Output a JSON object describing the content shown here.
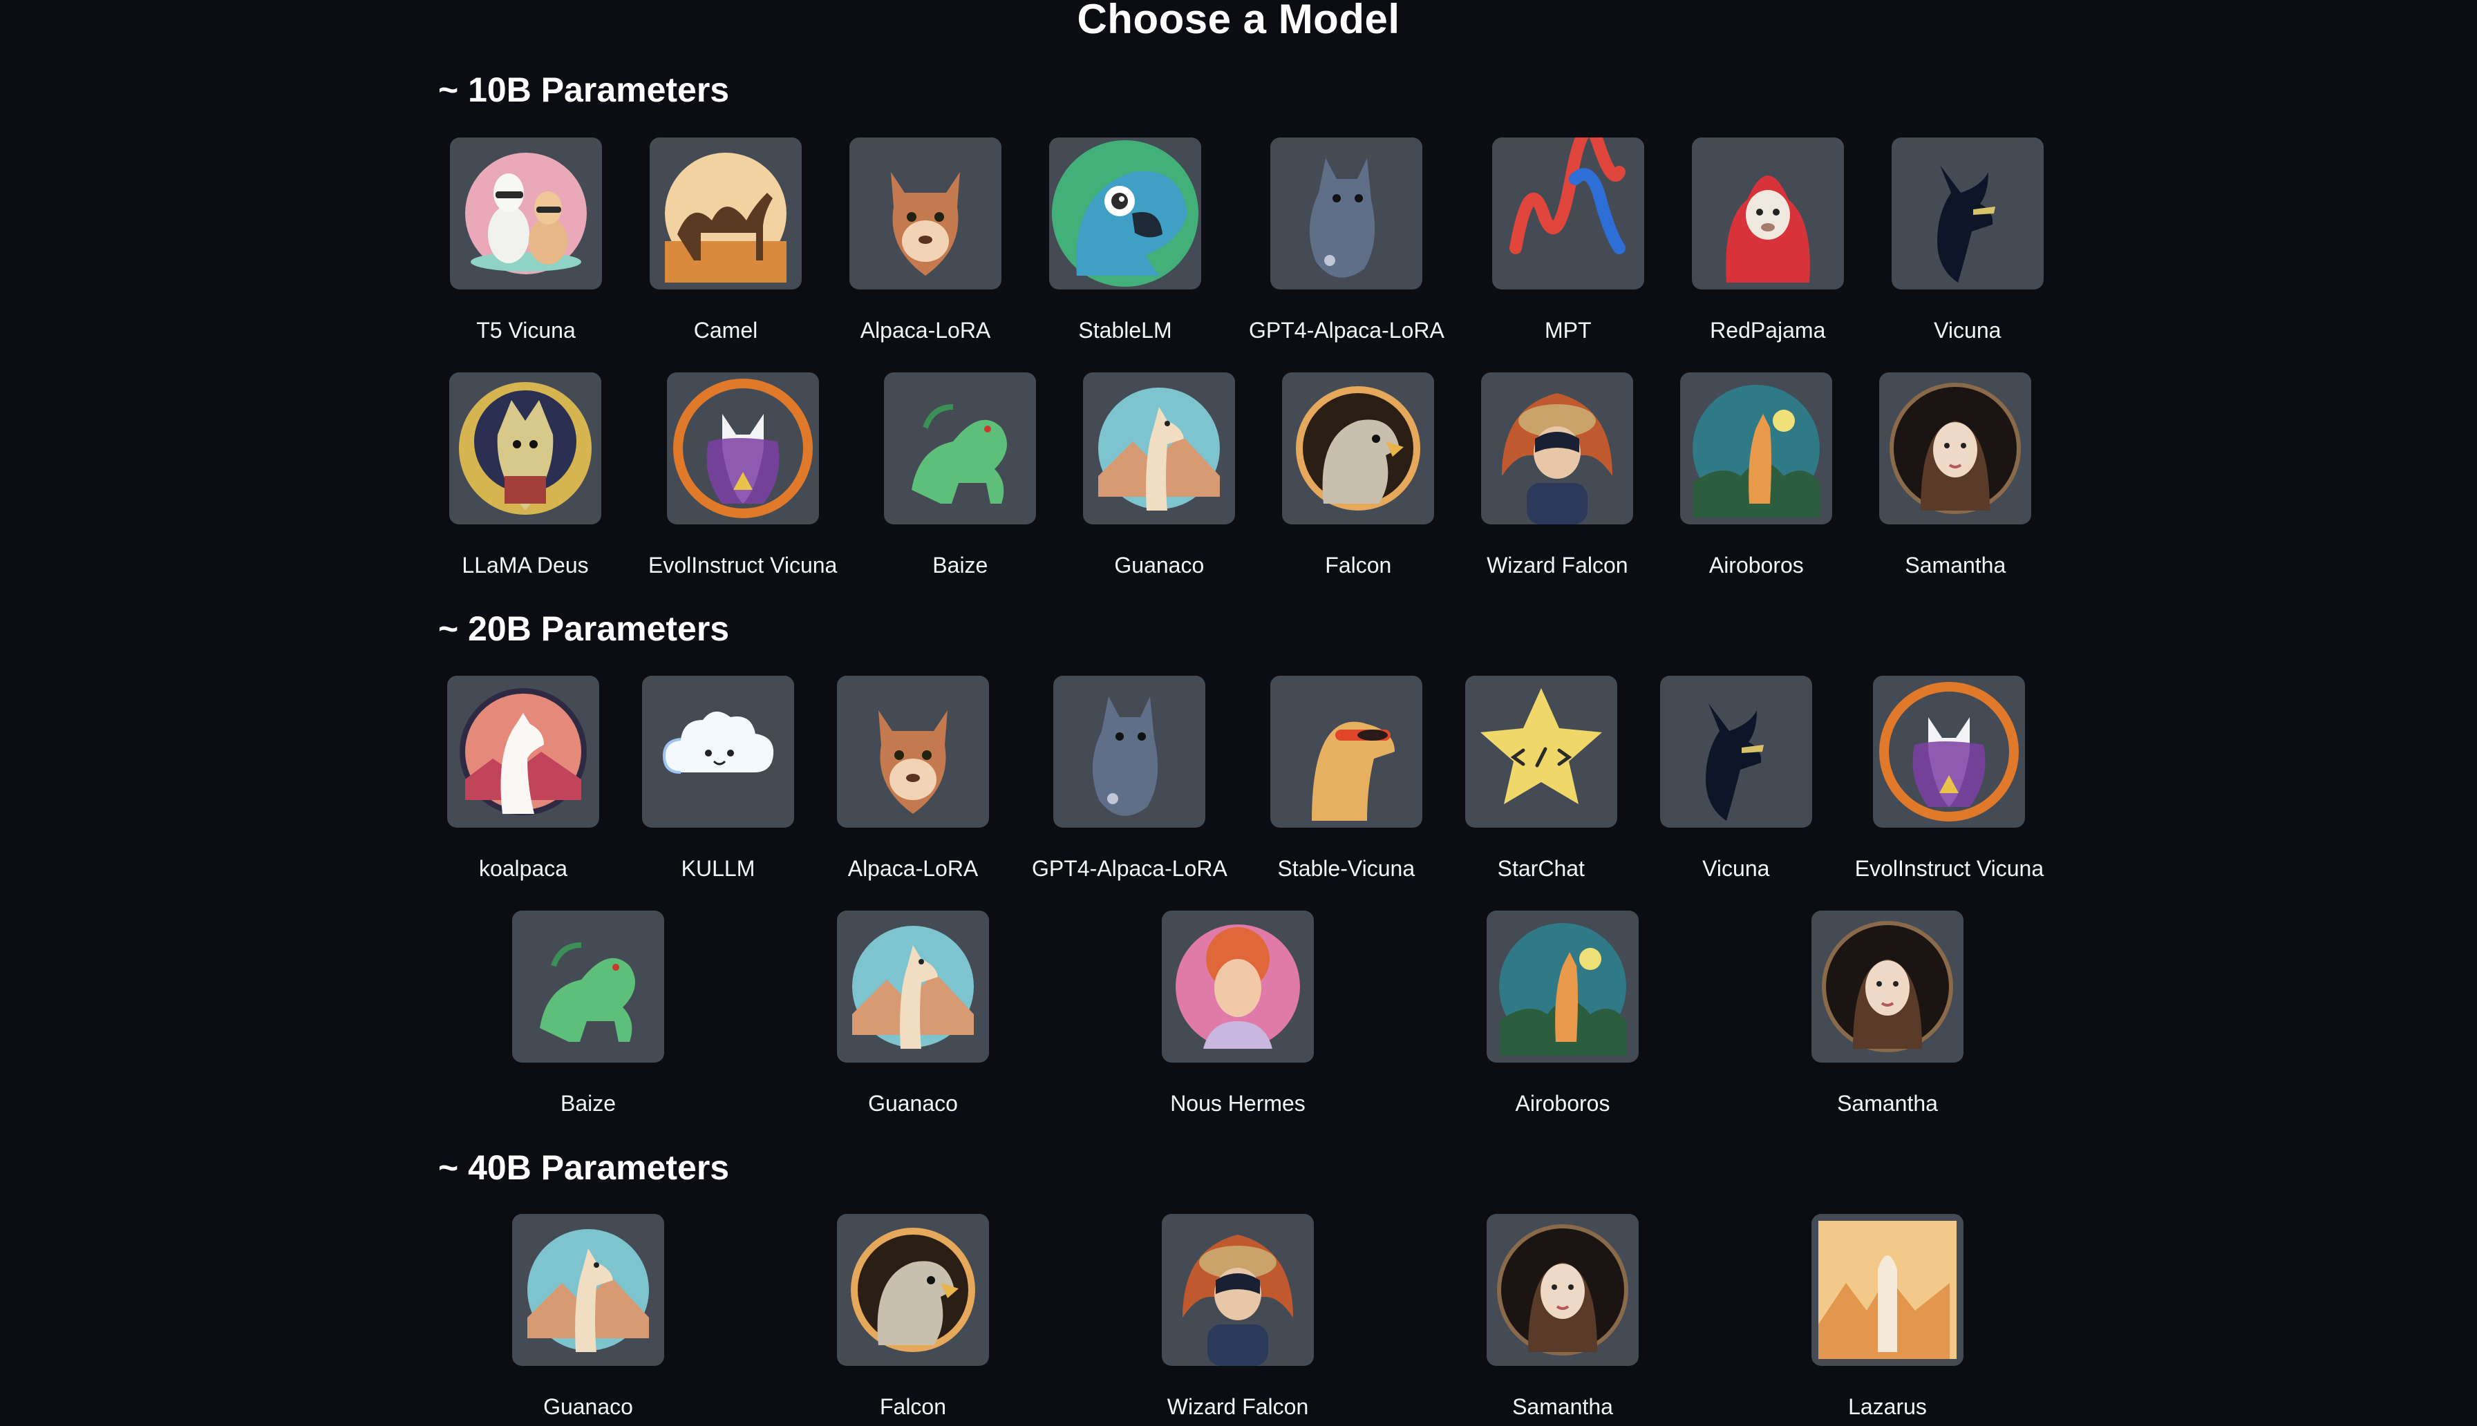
{
  "page": {
    "title": "Choose a Model"
  },
  "sections": [
    {
      "title": "~ 10B Parameters",
      "rows": [
        [
          {
            "label": "T5 Vicuna",
            "icon": "two-llamas-icon"
          },
          {
            "label": "Camel",
            "icon": "camel-icon"
          },
          {
            "label": "Alpaca-LoRA",
            "icon": "alpaca-icon"
          },
          {
            "label": "StableLM",
            "icon": "parrot-icon"
          },
          {
            "label": "GPT4-Alpaca-LoRA",
            "icon": "gray-llama-icon"
          },
          {
            "label": "MPT",
            "icon": "mpt-logo-icon"
          },
          {
            "label": "RedPajama",
            "icon": "llama-hoodie-icon"
          },
          {
            "label": "Vicuna",
            "icon": "vicuna-silhouette-icon"
          }
        ],
        [
          {
            "label": "LLaMA Deus",
            "icon": "llama-deus-icon"
          },
          {
            "label": "EvolInstruct Vicuna",
            "icon": "wizard-fox-icon"
          },
          {
            "label": "Baize",
            "icon": "green-dragon-icon"
          },
          {
            "label": "Guanaco",
            "icon": "guanaco-icon"
          },
          {
            "label": "Falcon",
            "icon": "falcon-icon"
          },
          {
            "label": "Wizard Falcon",
            "icon": "wizard-falcon-icon"
          },
          {
            "label": "Airoboros",
            "icon": "airoboros-icon"
          },
          {
            "label": "Samantha",
            "icon": "samantha-icon"
          }
        ]
      ]
    },
    {
      "title": "~ 20B Parameters",
      "rows": [
        [
          {
            "label": "koalpaca",
            "icon": "koalpaca-icon"
          },
          {
            "label": "KULLM",
            "icon": "cloud-icon"
          },
          {
            "label": "Alpaca-LoRA",
            "icon": "alpaca-icon"
          },
          {
            "label": "GPT4-Alpaca-LoRA",
            "icon": "gray-llama-icon"
          },
          {
            "label": "Stable-Vicuna",
            "icon": "llama-sunglasses-icon"
          },
          {
            "label": "StarChat",
            "icon": "star-code-icon"
          },
          {
            "label": "Vicuna",
            "icon": "vicuna-silhouette-icon"
          },
          {
            "label": "EvolInstruct Vicuna",
            "icon": "wizard-fox-icon"
          }
        ],
        [
          {
            "label": "Baize",
            "icon": "green-dragon-icon"
          },
          {
            "label": "Guanaco",
            "icon": "guanaco-icon"
          },
          {
            "label": "Nous Hermes",
            "icon": "hermes-bust-icon"
          },
          {
            "label": "Airoboros",
            "icon": "airoboros-icon"
          },
          {
            "label": "Samantha",
            "icon": "samantha-icon"
          }
        ]
      ]
    },
    {
      "title": "~ 40B Parameters",
      "rows": [
        [
          {
            "label": "Guanaco",
            "icon": "guanaco-icon"
          },
          {
            "label": "Falcon",
            "icon": "falcon-icon"
          },
          {
            "label": "Wizard Falcon",
            "icon": "wizard-falcon-icon"
          },
          {
            "label": "Samantha",
            "icon": "samantha-icon"
          },
          {
            "label": "Lazarus",
            "icon": "lazarus-icon"
          }
        ]
      ]
    }
  ]
}
